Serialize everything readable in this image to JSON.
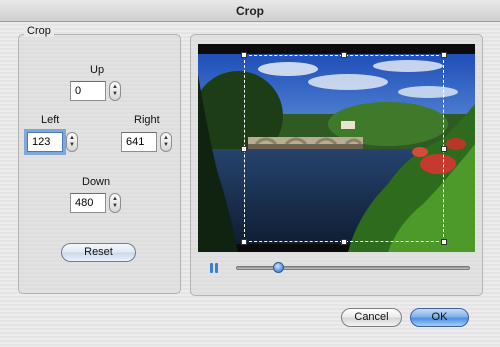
{
  "window": {
    "title": "Crop"
  },
  "crop_group": {
    "title": "Crop",
    "up": {
      "label": "Up",
      "value": "0"
    },
    "left": {
      "label": "Left",
      "value": "123"
    },
    "right": {
      "label": "Right",
      "value": "641"
    },
    "down": {
      "label": "Down",
      "value": "480"
    },
    "reset_label": "Reset"
  },
  "preview": {
    "playback_progress": 0.16
  },
  "footer": {
    "cancel_label": "Cancel",
    "ok_label": "OK"
  },
  "colors": {
    "accent": "#4f8ee0",
    "focus_ring": "#7fa7d8"
  },
  "icons": {
    "pause": "pause-icon",
    "stepper": "stepper-arrows-icon"
  }
}
